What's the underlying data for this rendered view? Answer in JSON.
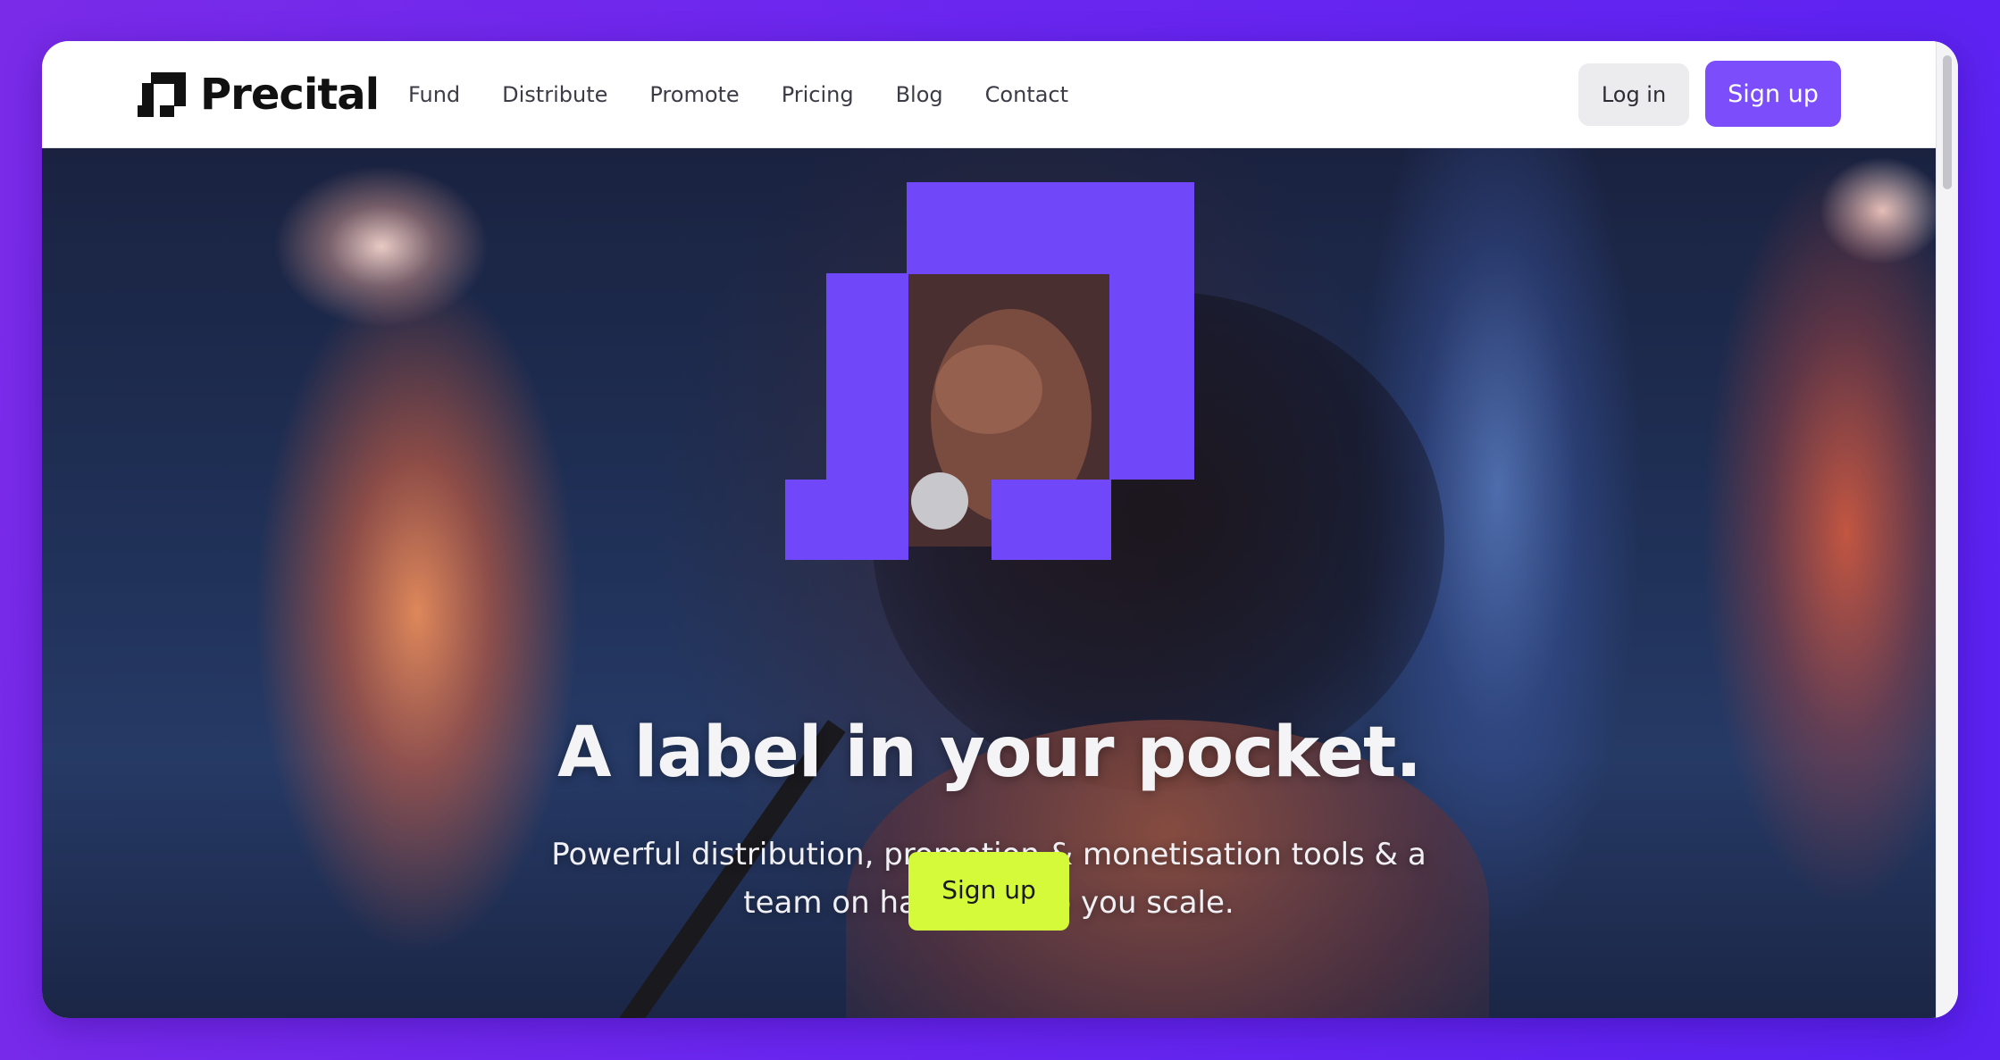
{
  "brand": {
    "name": "Precital",
    "logo_icon": "precital-logo-mark"
  },
  "nav": {
    "links": [
      "Fund",
      "Distribute",
      "Promote",
      "Pricing",
      "Blog",
      "Contact"
    ],
    "login_label": "Log in",
    "signup_label": "Sign up"
  },
  "hero": {
    "title": "A label in your pocket.",
    "subtitle": "Powerful distribution, promotion & monetisation tools & a team on hand to help you scale.",
    "cta_label": "Sign up",
    "logo_icon": "precital-logo-graphic"
  },
  "colors": {
    "background": "#6a26ef",
    "brand_purple": "#7b4dfb",
    "cta_lime": "#d4fa3a",
    "text_dark": "#111111"
  }
}
